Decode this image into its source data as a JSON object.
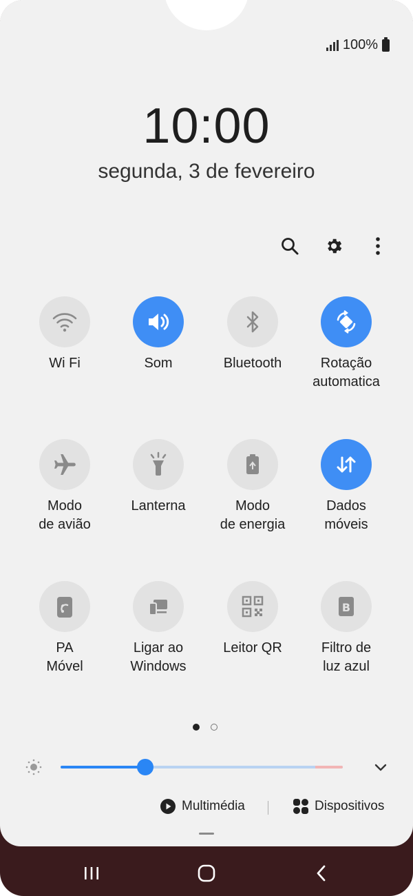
{
  "status_bar": {
    "battery": "100%",
    "signal_icon": "signal-icon",
    "battery_icon": "battery-icon"
  },
  "lock": {
    "time": "10:00",
    "date": "segunda, 3 de fevereiro"
  },
  "toolbar": {
    "search_icon": "search-icon",
    "settings_icon": "gear-icon",
    "more_icon": "more-vertical-icon"
  },
  "tiles": [
    {
      "label": "Wi Fi",
      "state": "off",
      "icon": "wifi-icon"
    },
    {
      "label": "Som",
      "state": "on",
      "icon": "speaker-icon"
    },
    {
      "label": "Bluetooth",
      "state": "off",
      "icon": "bluetooth-icon"
    },
    {
      "label": "Rotação automatica",
      "state": "on",
      "icon": "auto-rotate-icon"
    },
    {
      "label": "Modo de avião",
      "state": "off",
      "icon": "airplane-icon"
    },
    {
      "label": "Lanterna",
      "state": "off",
      "icon": "flashlight-icon"
    },
    {
      "label": "Modo de energia",
      "state": "off",
      "icon": "battery-saver-icon"
    },
    {
      "label": "Dados móveis",
      "state": "on",
      "icon": "mobile-data-icon"
    },
    {
      "label": "PA Móvel",
      "state": "off",
      "icon": "hotspot-icon"
    },
    {
      "label": "Ligar ao Windows",
      "state": "off",
      "icon": "link-to-windows-icon"
    },
    {
      "label": "Leitor QR",
      "state": "off",
      "icon": "qr-code-icon"
    },
    {
      "label": "Filtro de luz azul",
      "state": "off",
      "icon": "blue-light-filter-icon"
    }
  ],
  "page_indicator": {
    "current": 1,
    "total": 2
  },
  "brightness": {
    "level": 0.3,
    "icon": "brightness-icon",
    "expand_icon": "chevron-down-icon"
  },
  "media": {
    "multimedia_label": "Multimédia",
    "devices_label": "Dispositivos"
  },
  "colors": {
    "accent": "#3f8ef5",
    "panel": "#f1f1f1",
    "tile_off": "#e2e2e2",
    "nav_bar": "#3a1b1d"
  },
  "nav": {
    "recents_icon": "recents-icon",
    "home_icon": "home-icon",
    "back_icon": "back-icon"
  }
}
